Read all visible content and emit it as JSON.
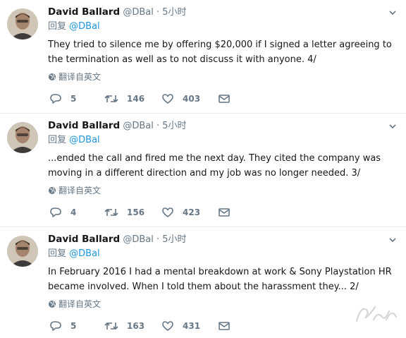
{
  "tweets": [
    {
      "name": "David Ballard",
      "handle": "@DBal",
      "dot": "·",
      "time": "5小时",
      "reply_prefix": "回复",
      "reply_to": "@DBal",
      "text": "They tried to silence me by offering $20,000 if I signed a letter agreeing to the termination as well as to not discuss it with anyone. 4/",
      "translate": "翻译自英文",
      "replies": "5",
      "retweets": "146",
      "likes": "403"
    },
    {
      "name": "David Ballard",
      "handle": "@DBal",
      "dot": "·",
      "time": "5小时",
      "reply_prefix": "回复",
      "reply_to": "@DBal",
      "text": "...ended the call and fired me the next day. They cited the company was moving in a different direction and my job was no longer needed. 3/",
      "translate": "翻译自英文",
      "replies": "4",
      "retweets": "156",
      "likes": "423"
    },
    {
      "name": "David Ballard",
      "handle": "@DBal",
      "dot": "·",
      "time": "5小时",
      "reply_prefix": "回复",
      "reply_to": "@DBal",
      "text": "In February 2016 I had a mental breakdown at work & Sony Playstation HR became involved. When I told them about the harassment they... 2/",
      "translate": "翻译自英文",
      "replies": "5",
      "retweets": "163",
      "likes": "431"
    }
  ],
  "colors": {
    "text": "#14171a",
    "muted": "#657786",
    "link": "#1b95e0",
    "divider": "#e6ecf0"
  },
  "icons": {
    "avatar": "avatar",
    "caret": "chevron-down-icon",
    "translate": "globe-icon",
    "reply": "reply-icon",
    "retweet": "retweet-icon",
    "like": "heart-icon",
    "dm": "envelope-icon",
    "watermark": "watermark-logo"
  }
}
